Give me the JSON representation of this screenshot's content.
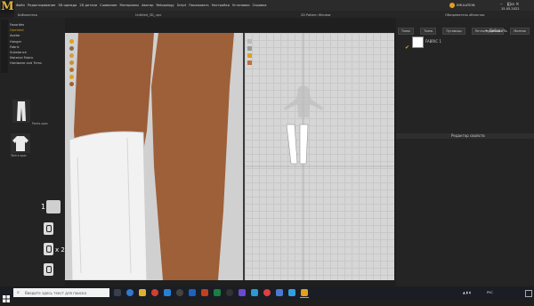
{
  "app": {
    "logo_letter": "M",
    "menu": [
      "Файл",
      "Редактирование",
      "3D одежда",
      "2D детали",
      "Сшивание",
      "Материалы",
      "Аватар",
      "Retopology",
      "Script",
      "Показывать",
      "Настройки",
      "Установки",
      "Справка"
    ],
    "user_label": "EMULATION"
  },
  "panels": {
    "library_title": "Библиотека",
    "file_tab": "Untitled_3D_.zpc",
    "pattern_title": "2D Pattern Window",
    "object_title": "Обозреватель объектов",
    "object_tabs": [
      "Ткань",
      "Ткань",
      "Пуговицы",
      "Петли/пуговицы",
      "Молнии"
    ],
    "add_button": "+ Добавить",
    "fabric_item": "FABRIC 1",
    "property_title": "Редактор свойств"
  },
  "library": {
    "items": [
      "Favorites",
      "Garment",
      "Avatar",
      "Hanger",
      "Fabric",
      "Substance",
      "Material Fabric",
      "Hardware and Trims"
    ],
    "selected_index": 1,
    "thumbs": [
      {
        "label": "Pants.zpac"
      },
      {
        "label": "Tshirt.zpac"
      }
    ]
  },
  "overlay": {
    "step1": "1",
    "x2": "x 2"
  },
  "taskbar": {
    "search_placeholder": "Введите здесь текст для поиска",
    "time": "8:45",
    "date": "15.05.2022",
    "lang": "РУС"
  },
  "colors": {
    "accent": "#e0a020",
    "skin": "#9a5d38",
    "viewport_bg": "#d0d0d0",
    "pattern_bg": "#d6d6d6"
  }
}
